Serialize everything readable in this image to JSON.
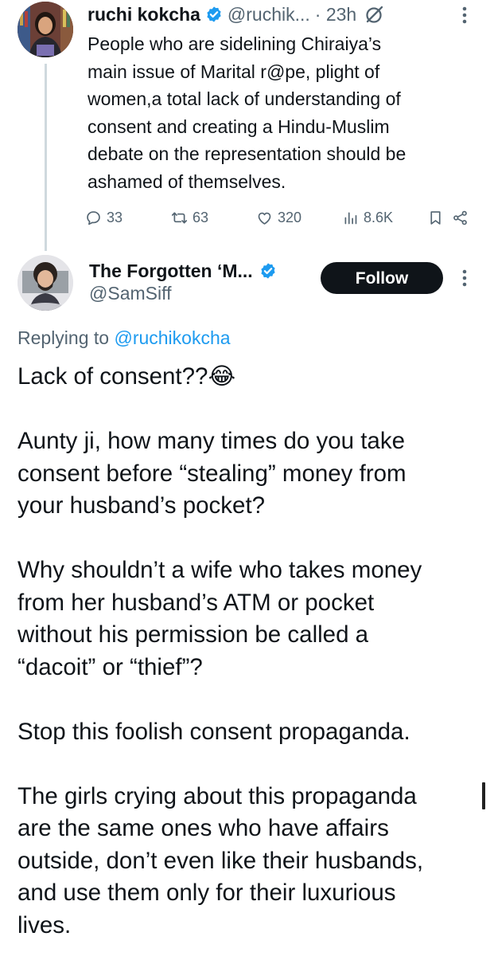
{
  "parent_tweet": {
    "author_name": "ruchi kokcha",
    "handle": "@ruchik...",
    "time": "· 23h",
    "text": "People who are sidelining Chiraiya’s\nmain issue of Marital r@pe, plight of\nwomen,a total lack of understanding of\nconsent and creating a Hindu-Muslim\ndebate on the representation should be\nashamed of themselves.",
    "icons": [
      "avatar",
      "verified-icon",
      "grok-icon",
      "more-icon"
    ],
    "actions": {
      "replies": "33",
      "reposts": "63",
      "likes": "320",
      "views": "8.6K"
    },
    "action_icons": [
      "reply-icon",
      "repost-icon",
      "like-icon",
      "views-icon",
      "bookmark-icon",
      "share-icon"
    ]
  },
  "reply_tweet": {
    "author_name": "The Forgotten ‘M...",
    "handle": "@SamSiff",
    "follow_label": "Follow",
    "replying_prefix": "Replying to",
    "replying_mention": "@ruchikokcha",
    "text": "Lack of consent??😂\n\nAunty ji, how many times do you take\nconsent before “stealing” money from\nyour husband’s pocket?\n\nWhy shouldn’t a wife who takes money\nfrom her husband’s ATM or pocket\nwithout his permission be called a\n“dacoit” or “thief”?\n\nStop this foolish consent propaganda.\n\nThe girls crying about this propaganda\nare the same ones who have affairs\noutside, don’t even like their husbands,\nand use them only for their luxurious\nlives."
  },
  "colors": {
    "text": "#0f1419",
    "muted": "#536471",
    "link": "#1d9bf0",
    "verified": "#1d9bf0",
    "thread_line": "#cfd9de",
    "follow_bg": "#0f1419"
  }
}
